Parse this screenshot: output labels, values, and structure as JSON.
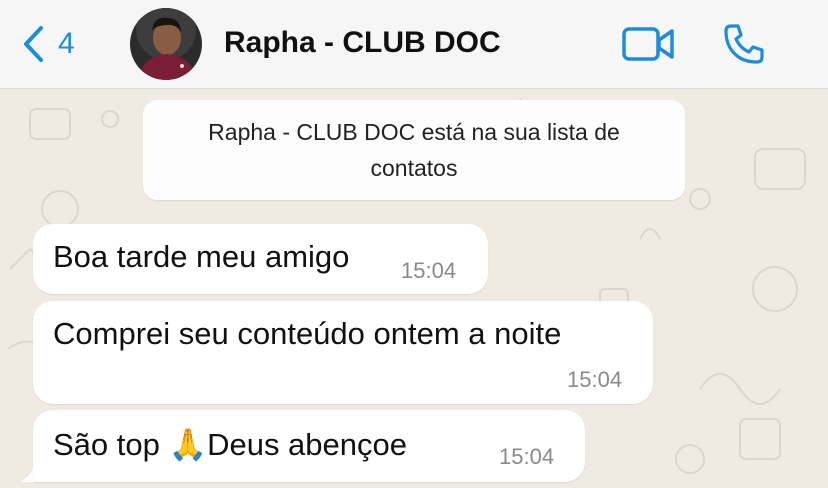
{
  "header": {
    "back_count": "4",
    "contact_name": "Rapha - CLUB DOC",
    "icons": [
      "chevron-left-icon",
      "video-camera-icon",
      "phone-icon"
    ],
    "accent_color": "#1e8cd8"
  },
  "notice": {
    "text": "Rapha - CLUB DOC está na sua lista de contatos"
  },
  "messages": [
    {
      "text": "Boa tarde meu amigo",
      "time": "15:04"
    },
    {
      "text": "Comprei seu conteúdo ontem a noite",
      "time": "15:04"
    },
    {
      "text": "São top 🙏Deus abençoe",
      "time": "15:04"
    }
  ]
}
